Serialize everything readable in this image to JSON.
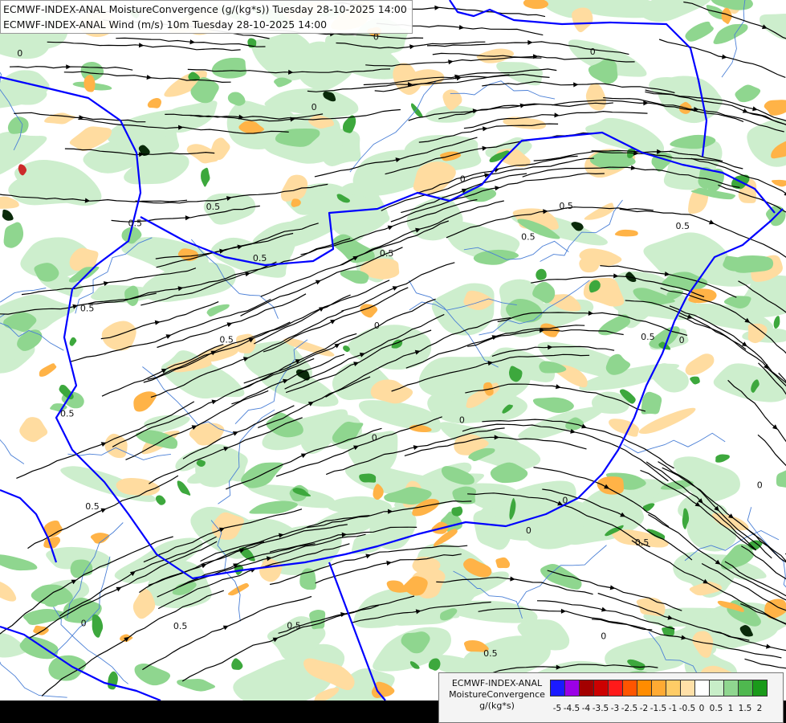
{
  "title": {
    "line1": "ECMWF-INDEX-ANAL MoistureConvergence (g/(kg*s)) Tuesday 28-10-2025 14:00",
    "line2": "ECMWF-INDEX-ANAL Wind (m/s) 10m Tuesday 28-10-2025 14:00"
  },
  "legend": {
    "line1": "ECMWF-INDEX-ANAL",
    "line2": "MoistureConvergence",
    "line3": "g/(kg*s)",
    "ticks": [
      "-5",
      "-4.5",
      "-4",
      "-3.5",
      "-3",
      "-2.5",
      "-2",
      "-1.5",
      "-1",
      "-0.5",
      "0",
      "0.5",
      "1",
      "1.5",
      "2"
    ],
    "colors": [
      "#1a1aff",
      "#9b00e6",
      "#a30000",
      "#cc0000",
      "#ff1a1a",
      "#ff5500",
      "#ff8c00",
      "#ffaa33",
      "#ffcc66",
      "#ffe0a8",
      "#ffffff",
      "#c8eec8",
      "#8fd68f",
      "#4fb84f",
      "#1a9a1a"
    ]
  },
  "contour_labels": [
    "0",
    "0.5"
  ],
  "colors": {
    "background": "#ffffff",
    "border": "#0000ff",
    "river": "#4a7fd6",
    "streamline": "#000000",
    "green_light": "#cdeecd",
    "green_mid": "#8fd68f",
    "green_dark": "#3da83d",
    "orange_light": "#ffdca0",
    "orange_mid": "#ffb347",
    "dark_core": "#0a2a0a"
  }
}
